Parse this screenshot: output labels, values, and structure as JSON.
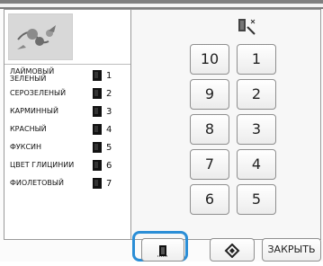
{
  "colors": [
    {
      "name": "ЛАЙМОВЫЙ ЗЕЛЕНЫЙ",
      "number": "1"
    },
    {
      "name": "СЕРОЗЕЛЕНЫЙ",
      "number": "2"
    },
    {
      "name": "КАРМИННЫЙ",
      "number": "3"
    },
    {
      "name": "КРАСНЫЙ",
      "number": "4"
    },
    {
      "name": "ФУКСИН",
      "number": "5"
    },
    {
      "name": "ЦВЕТ ГЛИЦИНИИ",
      "number": "6"
    },
    {
      "name": "ФИОЛЕТОВЫЙ",
      "number": "7"
    }
  ],
  "number_buttons": [
    "10",
    "1",
    "9",
    "2",
    "8",
    "3",
    "7",
    "4",
    "6",
    "5"
  ],
  "bottom": {
    "close_label": "ЗАКРЫТЬ"
  },
  "icons": {
    "preview": "embroidery-preview-icon",
    "sequence": "thread-sequence-icon",
    "spool": "spool-icon",
    "dial": "dial-icon"
  },
  "colors_meta": {
    "accent": "#2b8ed6"
  }
}
